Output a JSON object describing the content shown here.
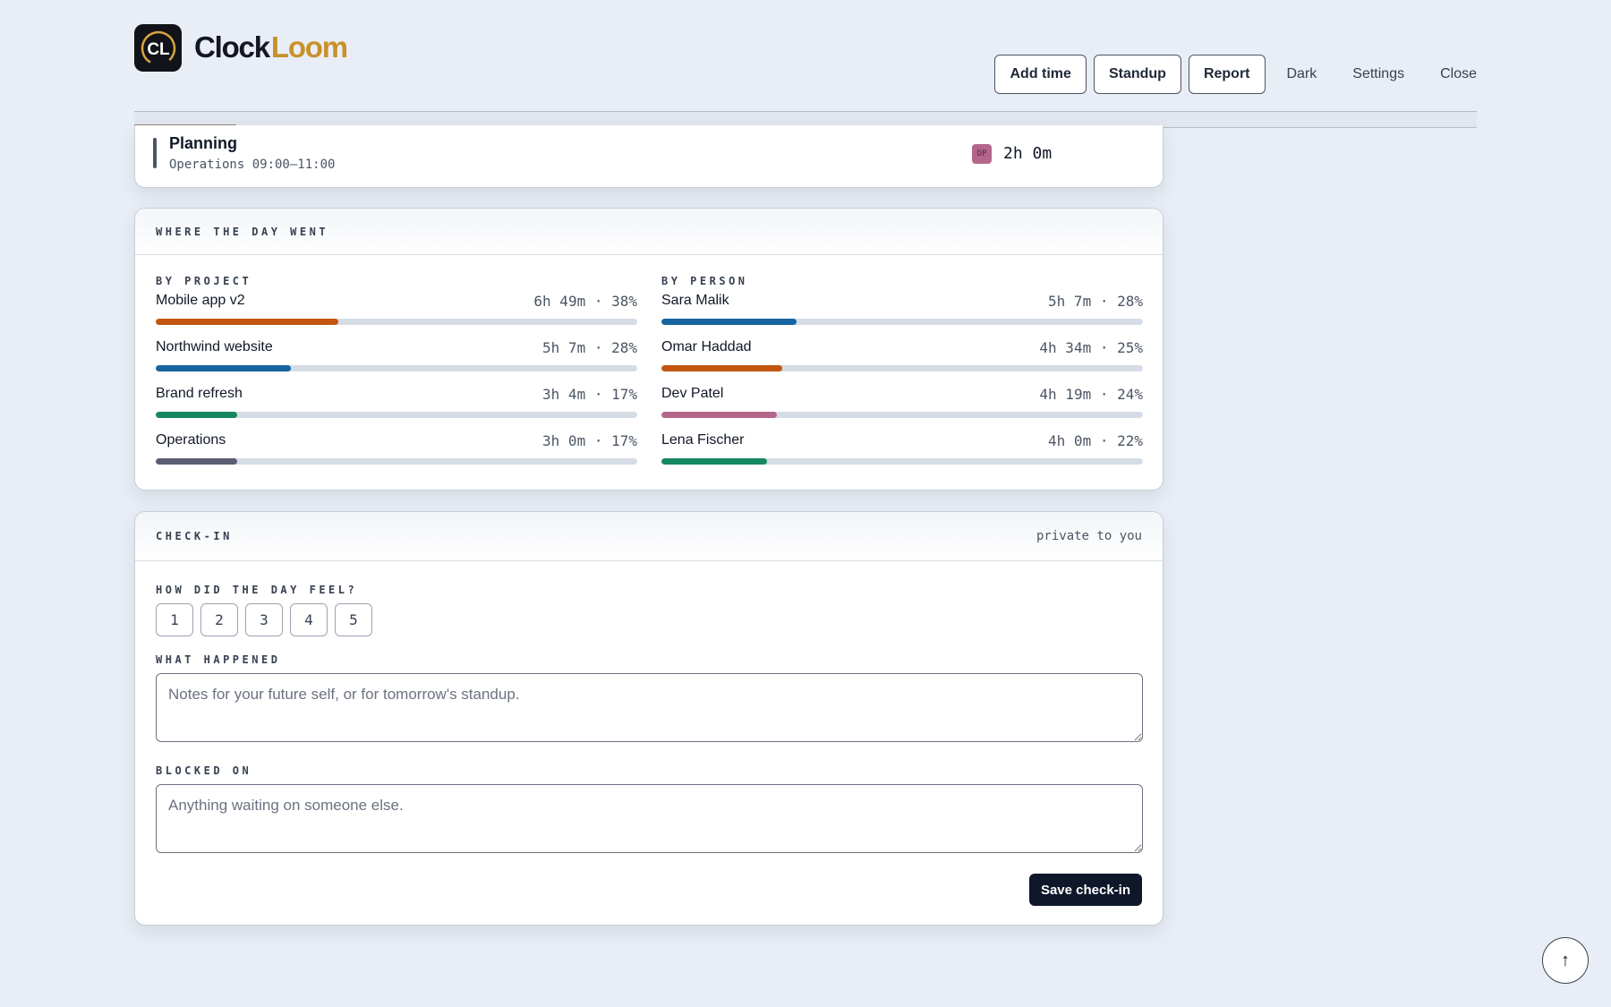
{
  "app": {
    "logo_initials": "CL",
    "name_part1": "Clock",
    "name_part2": "Loom"
  },
  "nav": {
    "add_time": "Add time",
    "standup": "Standup",
    "report": "Report",
    "dark": "Dark",
    "settings": "Settings",
    "close": "Close"
  },
  "entry": {
    "title": "Planning",
    "subtitle": "Operations 09:00–11:00",
    "avatar": "DP",
    "duration": "2h 0m"
  },
  "breakdown": {
    "heading": "WHERE THE DAY WENT",
    "by_project_label": "BY PROJECT",
    "by_person_label": "BY PERSON",
    "projects": [
      {
        "name": "Mobile app v2",
        "value": "6h 49m · 38%",
        "pct": 38,
        "color": "#c2560f"
      },
      {
        "name": "Northwind website",
        "value": "5h 7m · 28%",
        "pct": 28,
        "color": "#1664a0"
      },
      {
        "name": "Brand refresh",
        "value": "3h 4m · 17%",
        "pct": 17,
        "color": "#148761"
      },
      {
        "name": "Operations",
        "value": "3h 0m · 17%",
        "pct": 17,
        "color": "#5b5e72"
      }
    ],
    "people": [
      {
        "name": "Sara Malik",
        "value": "5h 7m · 28%",
        "pct": 28,
        "color": "#1664a0"
      },
      {
        "name": "Omar Haddad",
        "value": "4h 34m · 25%",
        "pct": 25,
        "color": "#c2560f"
      },
      {
        "name": "Dev Patel",
        "value": "4h 19m · 24%",
        "pct": 24,
        "color": "#b4668a"
      },
      {
        "name": "Lena Fischer",
        "value": "4h 0m · 22%",
        "pct": 22,
        "color": "#148761"
      }
    ]
  },
  "checkin": {
    "heading": "CHECK-IN",
    "privacy": "private to you",
    "feel_label": "HOW DID THE DAY FEEL?",
    "feel_options": [
      "1",
      "2",
      "3",
      "4",
      "5"
    ],
    "happened_label": "WHAT HAPPENED",
    "happened_placeholder": "Notes for your future self, or for tomorrow's standup.",
    "blocked_label": "BLOCKED ON",
    "blocked_placeholder": "Anything waiting on someone else.",
    "save_label": "Save check-in"
  },
  "scroll_top_icon": "↑"
}
